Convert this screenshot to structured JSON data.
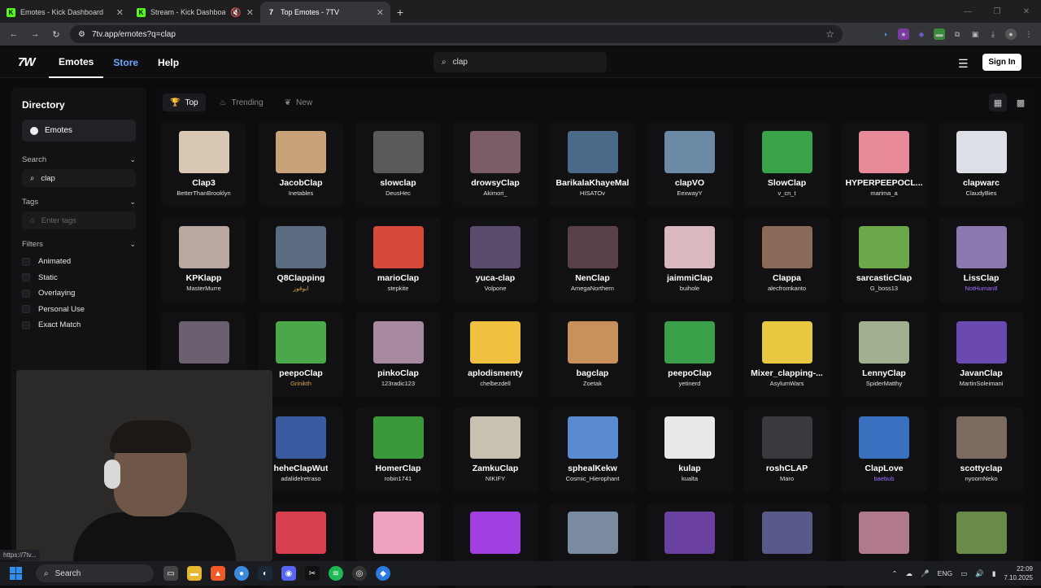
{
  "browser": {
    "tabs": [
      {
        "title": "Emotes - Kick Dashboard",
        "icon": "K"
      },
      {
        "title": "Stream - Kick Dashboard",
        "icon": "K"
      },
      {
        "title": "Top Emotes - 7TV",
        "icon": "7"
      }
    ],
    "url": "7tv.app/emotes?q=clap",
    "status_url": "https://7tv..."
  },
  "site": {
    "logo": "7W",
    "nav": [
      "Emotes",
      "Store",
      "Help"
    ],
    "search_value": "clap",
    "sign_in": "Sign In"
  },
  "sidebar": {
    "title": "Directory",
    "emotes_label": "Emotes",
    "search_label": "Search",
    "search_value": "clap",
    "tags_label": "Tags",
    "tags_placeholder": "Enter tags",
    "filters_label": "Filters",
    "filters": [
      "Animated",
      "Static",
      "Overlaying",
      "Personal Use",
      "Exact Match"
    ]
  },
  "modes": [
    "Top",
    "Trending",
    "New"
  ],
  "emotes": [
    {
      "name": "Clap3",
      "owner": "BetterThanBrooklyn",
      "color": "#d8c7b3"
    },
    {
      "name": "JacobClap",
      "owner": "Inetables",
      "color": "#c9a27a"
    },
    {
      "name": "slowclap",
      "owner": "DeusHec",
      "color": "#5a5a5a"
    },
    {
      "name": "drowsyClap",
      "owner": "Akimori_",
      "color": "#7a5c64"
    },
    {
      "name": "BarikalaKhayeMal",
      "owner": "HISATOv",
      "color": "#4a6a8a"
    },
    {
      "name": "clapVO",
      "owner": "EexwayY",
      "color": "#6c8aa6"
    },
    {
      "name": "SlowClap",
      "owner": "v_cn_t",
      "color": "#3aa34a"
    },
    {
      "name": "HYPERPEEPOCL...",
      "owner": "marima_a",
      "color": "#e98a9a"
    },
    {
      "name": "clapwarc",
      "owner": "ClaudyBies",
      "color": "#dcdfe6"
    },
    {
      "name": "KPKlapp",
      "owner": "MasterMurre",
      "color": "#b9a8a0"
    },
    {
      "name": "Q8Clapping",
      "owner": "ابوقوز",
      "color": "#5c6c80"
    },
    {
      "name": "marioClap",
      "owner": "stepkite",
      "color": "#d64a3a"
    },
    {
      "name": "yuca-clap",
      "owner": "Volpone",
      "color": "#5b4c6e"
    },
    {
      "name": "NenClap",
      "owner": "AmegaNorthern",
      "color": "#5a4048"
    },
    {
      "name": "jaimmiClap",
      "owner": "buihole",
      "color": "#d9b8c0"
    },
    {
      "name": "Clappa",
      "owner": "alecfromkanto",
      "color": "#8a6a58"
    },
    {
      "name": "sarcasticClap",
      "owner": "G_boss13",
      "color": "#6aa84a"
    },
    {
      "name": "LissClap",
      "owner": "NotHuman8",
      "color": "#8a7ab0"
    },
    {
      "name": "",
      "owner": "",
      "color": "#6a6070"
    },
    {
      "name": "peepoClap",
      "owner": "Grinikth",
      "color": "#4aa848"
    },
    {
      "name": "pinkoClap",
      "owner": "123radic123",
      "color": "#a88aa0"
    },
    {
      "name": "aplodismenty",
      "owner": "chelbezdell",
      "color": "#f0c040"
    },
    {
      "name": "bagclap",
      "owner": "Zoetak",
      "color": "#c8905a"
    },
    {
      "name": "peepoClap",
      "owner": "yetinerd",
      "color": "#3aa04a"
    },
    {
      "name": "Mixer_clapping-...",
      "owner": "AsylumWars",
      "color": "#e8c840"
    },
    {
      "name": "LennyClap",
      "owner": "SpiderMatthy",
      "color": "#a0b090"
    },
    {
      "name": "JavanClap",
      "owner": "MartinSoleimani",
      "color": "#6a4ab0"
    },
    {
      "name": "",
      "owner": "",
      "color": "#1a1a1c"
    },
    {
      "name": "heheClapWut",
      "owner": "adalidelretraso",
      "color": "#3a5aa0"
    },
    {
      "name": "HomerClap",
      "owner": "robin1741",
      "color": "#3a9a3a"
    },
    {
      "name": "ZamkuClap",
      "owner": "NIKIFY",
      "color": "#c8c0b0"
    },
    {
      "name": "sphealKekw",
      "owner": "Cosmic_Hierophant",
      "color": "#5a8ad0"
    },
    {
      "name": "kulap",
      "owner": "kualta",
      "color": "#e8e8e8"
    },
    {
      "name": "roshCLAP",
      "owner": "Maro",
      "color": "#3a3a3e"
    },
    {
      "name": "ClapLove",
      "owner": "baebub",
      "color": "#3a70c0"
    },
    {
      "name": "scottyclap",
      "owner": "nyoomNeko",
      "color": "#7a6a60"
    },
    {
      "name": "",
      "owner": "",
      "color": "#1a1a1c"
    },
    {
      "name": "",
      "owner": "",
      "color": "#d84050"
    },
    {
      "name": "",
      "owner": "",
      "color": "#f0a0c0"
    },
    {
      "name": "",
      "owner": "",
      "color": "#a040e0"
    },
    {
      "name": "",
      "owner": "",
      "color": "#7a8aa0"
    },
    {
      "name": "",
      "owner": "",
      "color": "#6a40a0"
    },
    {
      "name": "",
      "owner": "",
      "color": "#5a5a8a"
    },
    {
      "name": "",
      "owner": "",
      "color": "#b07a8a"
    },
    {
      "name": "",
      "owner": "",
      "color": "#6a8a4a"
    }
  ],
  "taskbar": {
    "search": "Search",
    "lang": "ENG",
    "time": "22:09",
    "date": "7.10.2025"
  }
}
